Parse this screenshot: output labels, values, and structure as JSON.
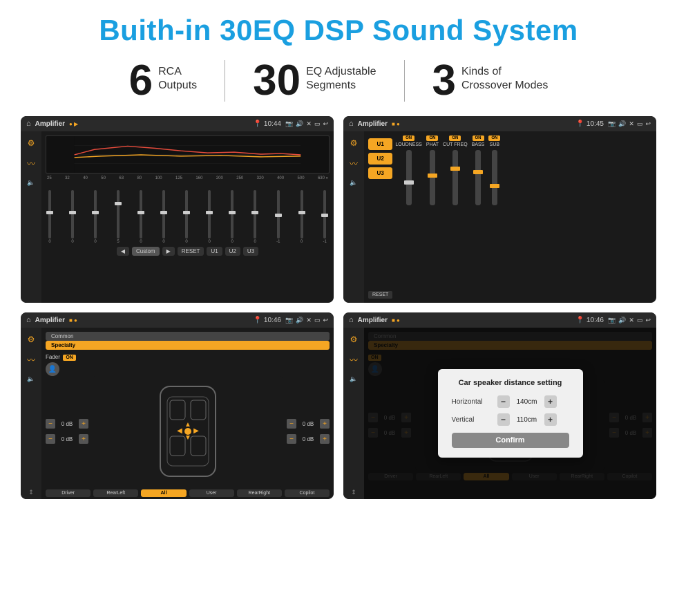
{
  "header": {
    "title": "Buith-in 30EQ DSP Sound System"
  },
  "stats": [
    {
      "number": "6",
      "line1": "RCA",
      "line2": "Outputs"
    },
    {
      "number": "30",
      "line1": "EQ Adjustable",
      "line2": "Segments"
    },
    {
      "number": "3",
      "line1": "Kinds of",
      "line2": "Crossover Modes"
    }
  ],
  "screens": [
    {
      "id": "screen1",
      "topbar": {
        "title": "Amplifier",
        "time": "10:44"
      },
      "eq_labels": [
        "25",
        "32",
        "40",
        "50",
        "63",
        "80",
        "100",
        "125",
        "160",
        "200",
        "250",
        "320",
        "400",
        "500",
        "630"
      ],
      "sliders": [
        0,
        0,
        0,
        5,
        0,
        0,
        0,
        0,
        0,
        0,
        -1,
        0,
        -1
      ],
      "buttons": [
        "Custom",
        "RESET",
        "U1",
        "U2",
        "U3"
      ]
    },
    {
      "id": "screen2",
      "topbar": {
        "title": "Amplifier",
        "time": "10:45"
      },
      "presets": [
        "U1",
        "U2",
        "U3"
      ],
      "channels": [
        {
          "label": "LOUDNESS",
          "on": true
        },
        {
          "label": "PHAT",
          "on": true
        },
        {
          "label": "CUT FREQ",
          "on": true
        },
        {
          "label": "BASS",
          "on": true
        },
        {
          "label": "SUB",
          "on": true
        }
      ]
    },
    {
      "id": "screen3",
      "topbar": {
        "title": "Amplifier",
        "time": "10:46"
      },
      "tabs": [
        "Common",
        "Specialty"
      ],
      "fader": "Fader",
      "fader_on": "ON",
      "db_controls": [
        "0 dB",
        "0 dB",
        "0 dB",
        "0 dB"
      ],
      "footer_buttons": [
        "Driver",
        "RearLeft",
        "All",
        "User",
        "RearRight",
        "Copilot"
      ]
    },
    {
      "id": "screen4",
      "topbar": {
        "title": "Amplifier",
        "time": "10:46"
      },
      "tabs": [
        "Common",
        "Specialty"
      ],
      "dialog": {
        "title": "Car speaker distance setting",
        "horizontal_label": "Horizontal",
        "horizontal_value": "140cm",
        "vertical_label": "Vertical",
        "vertical_value": "110cm",
        "confirm_label": "Confirm"
      },
      "footer_buttons": [
        "Driver",
        "RearLeft",
        "All",
        "User",
        "RearRight",
        "Copilot"
      ]
    }
  ]
}
